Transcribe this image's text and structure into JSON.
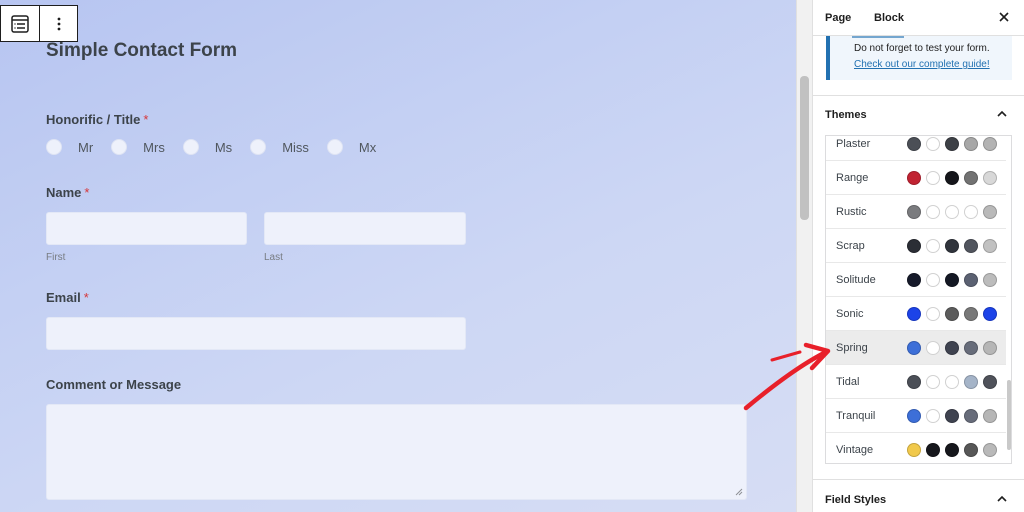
{
  "form": {
    "title": "Simple Contact Form",
    "required_mark": "*",
    "honorific": {
      "label": "Honorific / Title",
      "options": [
        "Mr",
        "Mrs",
        "Ms",
        "Miss",
        "Mx"
      ]
    },
    "name": {
      "label": "Name",
      "first_label": "First",
      "last_label": "Last"
    },
    "email": {
      "label": "Email"
    },
    "comment": {
      "label": "Comment or Message"
    }
  },
  "sidebar": {
    "tabs": [
      "Page",
      "Block"
    ],
    "notice": {
      "text": "Do not forget to test your form.",
      "link": "Check out our complete guide!"
    },
    "themes_title": "Themes",
    "field_styles_title": "Field Styles",
    "themes": [
      {
        "name": "Plaster",
        "colors": [
          "#4b4f56",
          "#ffffff",
          "#3d4046",
          "#a7a7a7",
          "#b3b3b3"
        ]
      },
      {
        "name": "Range",
        "colors": [
          "#c12332",
          "#ffffff",
          "#15161b",
          "#727272",
          "#d8d8d8"
        ]
      },
      {
        "name": "Rustic",
        "colors": [
          "#7a7b7e",
          "#ffffff",
          "#ffffff",
          "#ffffff",
          "#b9b9b9"
        ]
      },
      {
        "name": "Scrap",
        "colors": [
          "#2b2e35",
          "#ffffff",
          "#30343c",
          "#51555e",
          "#c1c1c1"
        ]
      },
      {
        "name": "Solitude",
        "colors": [
          "#161a2a",
          "#ffffff",
          "#141824",
          "#5b6172",
          "#bcbcbc"
        ]
      },
      {
        "name": "Sonic",
        "colors": [
          "#1c43e8",
          "#ffffff",
          "#5c5c5c",
          "#787878",
          "#1c43e8"
        ]
      },
      {
        "name": "Spring",
        "colors": [
          "#3d6fd8",
          "#ffffff",
          "#3f4350",
          "#676c7a",
          "#b6b6b6"
        ]
      },
      {
        "name": "Tidal",
        "colors": [
          "#4b4f57",
          "#ffffff",
          "#ffffff",
          "#a5b4c8",
          "#4f525a"
        ]
      },
      {
        "name": "Tranquil",
        "colors": [
          "#3d6fd8",
          "#ffffff",
          "#3f4350",
          "#676c7a",
          "#b6b6b6"
        ]
      },
      {
        "name": "Vintage",
        "colors": [
          "#f1c94b",
          "#16171c",
          "#16171c",
          "#575757",
          "#b9b9b9"
        ]
      }
    ],
    "selected_theme": "Spring"
  },
  "colors": {
    "accent": "#2271b1",
    "required": "#d63638",
    "annotation_arrow": "#e8202a"
  },
  "icons": {
    "block_type": "form-block-icon",
    "more": "vertical-ellipsis-icon",
    "close": "close-icon",
    "collapse": "chevron-up-icon"
  }
}
